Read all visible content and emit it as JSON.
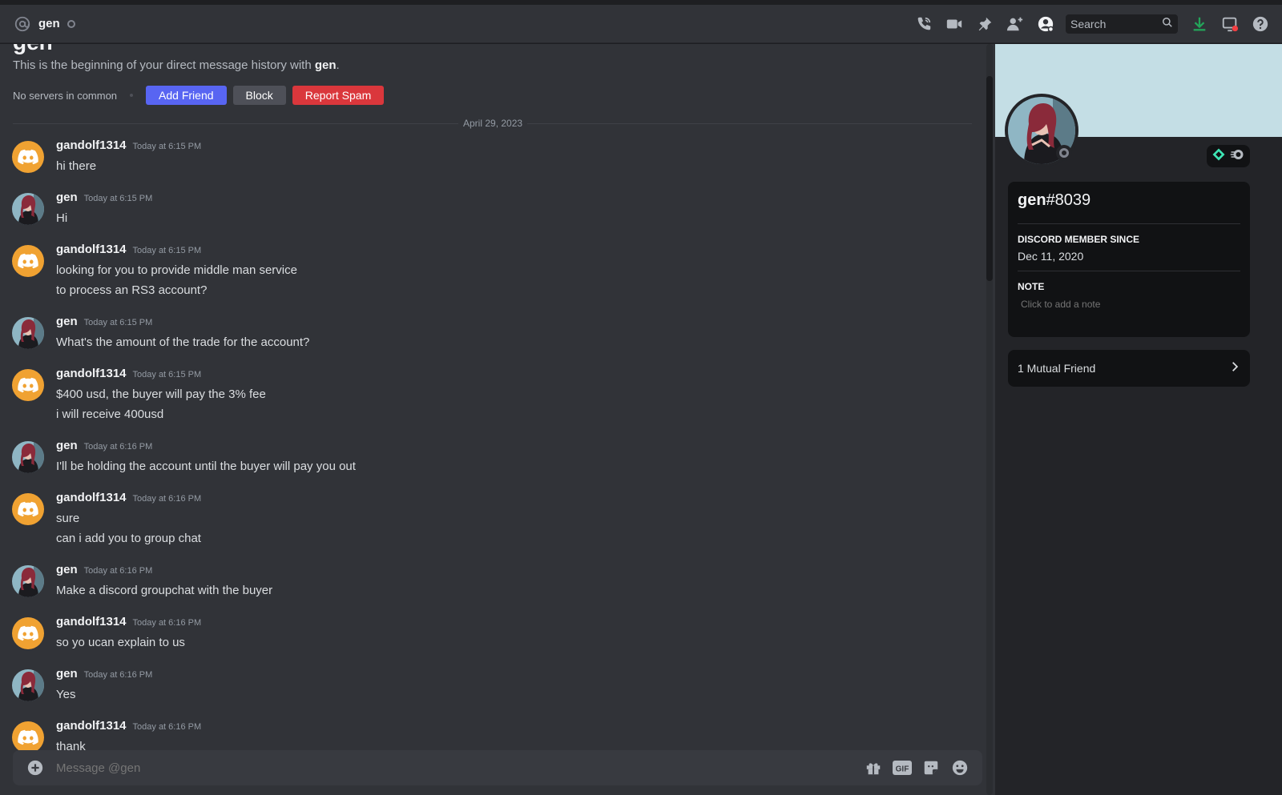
{
  "header": {
    "dm_name": "gen",
    "search_placeholder": "Search",
    "icons": [
      "at-sign-icon",
      "status-offline-icon",
      "voice-call-icon",
      "video-call-icon",
      "pinned-messages-icon",
      "add-friends-to-dm-icon",
      "hide-user-profile-icon",
      "search-icon",
      "download-icon",
      "screen-share-notification-icon",
      "help-icon"
    ]
  },
  "intro": {
    "title": "gen",
    "text_prefix": "This is the beginning of your direct message history with ",
    "text_name": "gen",
    "text_suffix": ".",
    "no_servers": "No servers in common",
    "add_friend": "Add Friend",
    "block": "Block",
    "report_spam": "Report Spam"
  },
  "date_divider": "April 29, 2023",
  "messages": [
    {
      "author": "gandolf1314",
      "time": "Today at 6:15 PM",
      "avatar": "discord",
      "lines": [
        "hi there"
      ]
    },
    {
      "author": "gen",
      "time": "Today at 6:15 PM",
      "avatar": "photo",
      "lines": [
        "Hi"
      ]
    },
    {
      "author": "gandolf1314",
      "time": "Today at 6:15 PM",
      "avatar": "discord",
      "lines": [
        "looking for you to provide middle man service",
        "to process an RS3 account?"
      ]
    },
    {
      "author": "gen",
      "time": "Today at 6:15 PM",
      "avatar": "photo",
      "lines": [
        "What's the amount of the trade for the account?"
      ]
    },
    {
      "author": "gandolf1314",
      "time": "Today at 6:15 PM",
      "avatar": "discord",
      "lines": [
        "$400 usd, the buyer will pay the 3% fee",
        "i will receive 400usd"
      ]
    },
    {
      "author": "gen",
      "time": "Today at 6:16 PM",
      "avatar": "photo",
      "lines": [
        "I'll be holding the account until the buyer will pay you out"
      ]
    },
    {
      "author": "gandolf1314",
      "time": "Today at 6:16 PM",
      "avatar": "discord",
      "lines": [
        "sure",
        "can i add you to group chat"
      ]
    },
    {
      "author": "gen",
      "time": "Today at 6:16 PM",
      "avatar": "photo",
      "lines": [
        "Make a discord groupchat with the buyer"
      ]
    },
    {
      "author": "gandolf1314",
      "time": "Today at 6:16 PM",
      "avatar": "discord",
      "lines": [
        "so yo ucan explain to us"
      ]
    },
    {
      "author": "gen",
      "time": "Today at 6:16 PM",
      "avatar": "photo",
      "lines": [
        "Yes"
      ]
    },
    {
      "author": "gandolf1314",
      "time": "Today at 6:16 PM",
      "avatar": "discord",
      "lines": [
        "thank"
      ]
    }
  ],
  "composer": {
    "placeholder": "Message @gen",
    "gif_label": "GIF"
  },
  "profile": {
    "username": "gen",
    "discriminator": "#8039",
    "member_since_label": "DISCORD MEMBER SINCE",
    "member_since": "Dec 11, 2020",
    "note_label": "NOTE",
    "note_placeholder": "Click to add a note",
    "mutual_friends": "1 Mutual Friend"
  },
  "colors": {
    "blurple": "#5865f2",
    "report_red": "#da373c",
    "download_green": "#23a55a",
    "discord_avatar_orange": "#f0a232",
    "banner": "#c4dee5"
  }
}
